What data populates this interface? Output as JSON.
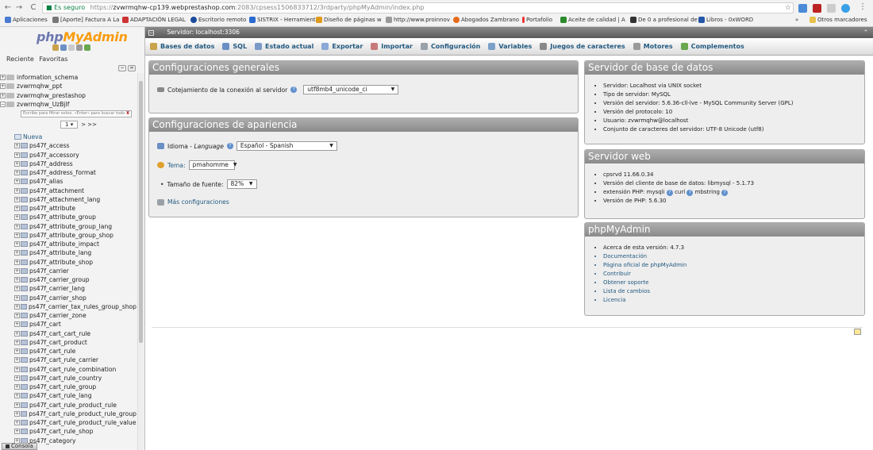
{
  "browser": {
    "security_label": "Es seguro",
    "url_scheme": "https://",
    "url_host": "zvwrmqhw-cp139.webprestashop.com",
    "url_path": ":2083/cpsess1506833712/3rdparty/phpMyAdmin/index.php",
    "bookmarks": [
      {
        "label": "Aplicaciones",
        "color": "#4a7bd0"
      },
      {
        "label": "[Aporte] Factura A La",
        "color": "#777"
      },
      {
        "label": "ADAPTACIÓN LEGAL",
        "color": "#c33"
      },
      {
        "label": "Escritorio remoto",
        "color": "#1a4b9c"
      },
      {
        "label": "SISTRIX - Herramient",
        "color": "#2a6ad0"
      },
      {
        "label": "Diseño de páginas w",
        "color": "#e09a1a"
      },
      {
        "label": "http://www.proinnov",
        "color": "#999"
      },
      {
        "label": "Abogados Zambrano",
        "color": "#e46a1a"
      },
      {
        "label": "Portafolio",
        "color": "#e33"
      },
      {
        "label": "Aceite de calidad | A",
        "color": "#2b8a2b"
      },
      {
        "label": "De 0 a profesional de",
        "color": "#333"
      },
      {
        "label": "Libros - 0xWORD",
        "color": "#2456a8"
      }
    ],
    "bookmarks_more": "»",
    "other_bookmarks": "Otros marcadores"
  },
  "sidebar": {
    "logo_php": "php",
    "logo_myadmin": "MyAdmin",
    "tab_recent": "Reciente",
    "tab_favorites": "Favoritas",
    "databases": [
      "information_schema",
      "zvwrmqhw_ppt",
      "zvwrmqhw_prestashop",
      "zvwrmqhw_UzBjlf"
    ],
    "filter_placeholder": "Escribe para filtrar estos, «Enter» para buscar todo",
    "filter_clear": "X",
    "pager_value": "1",
    "pager_next": "> >>",
    "new_label": "Nueva",
    "tables": [
      "ps47f_access",
      "ps47f_accessory",
      "ps47f_address",
      "ps47f_address_format",
      "ps47f_alias",
      "ps47f_attachment",
      "ps47f_attachment_lang",
      "ps47f_attribute",
      "ps47f_attribute_group",
      "ps47f_attribute_group_lang",
      "ps47f_attribute_group_shop",
      "ps47f_attribute_impact",
      "ps47f_attribute_lang",
      "ps47f_attribute_shop",
      "ps47f_carrier",
      "ps47f_carrier_group",
      "ps47f_carrier_lang",
      "ps47f_carrier_shop",
      "ps47f_carrier_tax_rules_group_shop",
      "ps47f_carrier_zone",
      "ps47f_cart",
      "ps47f_cart_cart_rule",
      "ps47f_cart_product",
      "ps47f_cart_rule",
      "ps47f_cart_rule_carrier",
      "ps47f_cart_rule_combination",
      "ps47f_cart_rule_country",
      "ps47f_cart_rule_group",
      "ps47f_cart_rule_lang",
      "ps47f_cart_rule_product_rule",
      "ps47f_cart_rule_product_rule_group",
      "ps47f_cart_rule_product_rule_value",
      "ps47f_cart_rule_shop",
      "ps47f_category"
    ]
  },
  "server_bar": "Servidor: localhost:3306",
  "tabs": [
    {
      "label": "Bases de datos",
      "color": "#c9a24a"
    },
    {
      "label": "SQL",
      "color": "#6a8fc4"
    },
    {
      "label": "Estado actual",
      "color": "#7a9ac8"
    },
    {
      "label": "Exportar",
      "color": "#8aa8d8"
    },
    {
      "label": "Importar",
      "color": "#c87a7a"
    },
    {
      "label": "Configuración",
      "color": "#9aa0a8"
    },
    {
      "label": "Variables",
      "color": "#7aa0c8"
    },
    {
      "label": "Juegos de caracteres",
      "color": "#888"
    },
    {
      "label": "Motores",
      "color": "#9a9a9a"
    },
    {
      "label": "Complementos",
      "color": "#6aa84f"
    }
  ],
  "general": {
    "title": "Configuraciones generales",
    "collation_label": "Cotejamiento de la conexión al servidor",
    "collation_value": "utf8mb4_unicode_ci"
  },
  "appearance": {
    "title": "Configuraciones de apariencia",
    "language_label": "Idioma - ",
    "language_label_italic": "Language",
    "language_value": "Español - Spanish",
    "theme_label": "Tema:",
    "theme_value": "pmahomme",
    "font_label": "Tamaño de fuente:",
    "font_value": "82%",
    "more_settings": "Más configuraciones"
  },
  "db_server": {
    "title": "Servidor de base de datos",
    "items": [
      "Servidor: Localhost via UNIX socket",
      "Tipo de servidor: MySQL",
      "Versión del servidor: 5.6.36-cll-lve - MySQL Community Server (GPL)",
      "Versión del protocolo: 10",
      "Usuario: zvwrmqhw@localhost",
      "Conjunto de caracteres del servidor: UTF-8 Unicode (utf8)"
    ]
  },
  "web_server": {
    "title": "Servidor web",
    "items": [
      "cpsrvd 11.66.0.34",
      "Versión del cliente de base de datos: libmysql - 5.1.73",
      "extensión PHP: mysqli",
      "curl",
      "mbstring",
      "Versión de PHP: 5.6.30"
    ]
  },
  "pma_panel": {
    "title": "phpMyAdmin",
    "version": "Acerca de esta versión: 4.7.3",
    "links": [
      "Documentación",
      "Página oficial de phpMyAdmin",
      "Contribuir",
      "Obtener soporte",
      "Lista de cambios",
      "Licencia"
    ]
  },
  "console_label": "Consola"
}
